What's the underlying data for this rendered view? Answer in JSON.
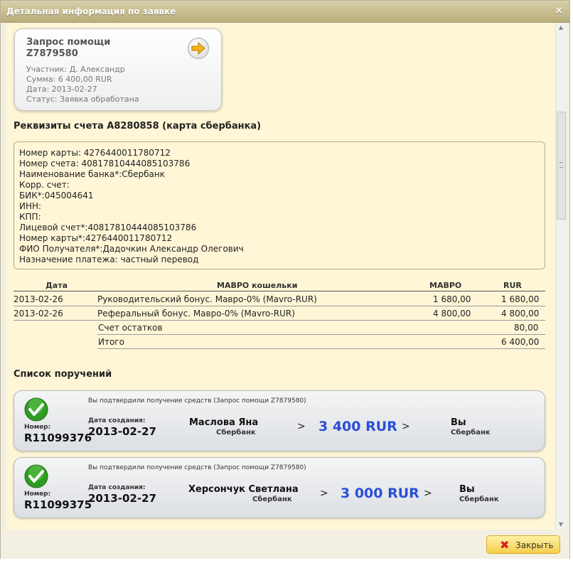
{
  "window": {
    "title": "Детальная информация по заявке",
    "close_glyph": "×"
  },
  "request": {
    "title_line1": "Запрос помощи",
    "title_line2": "Z7879580",
    "participant": "Участник: Д. Александр",
    "sum": "Сумма: 6 400,00 RUR",
    "date": "Дата: 2013-02-27",
    "status": "Статус: Заявка обработана"
  },
  "account": {
    "heading": "Реквизиты счета A8280858 (карта сбербанка)",
    "lines": [
      "Номер карты: 4276440011780712",
      "Номер счета: 40817810444085103786",
      "Наименование банка*:Сбербанк",
      "Корр. счет:",
      "БИК*:045004641",
      "ИНН:",
      "КПП:",
      "Лицевой счет*:40817810444085103786",
      "Номер карты*:4276440011780712",
      "ФИО Получателя*:Дадочкин Александр Олегович",
      "Назначение платежа: частный перевод"
    ]
  },
  "table": {
    "headers": {
      "date": "Дата",
      "wallets": "МАВРО кошельки",
      "mavro": "МАВРО",
      "rur": "RUR"
    },
    "rows": [
      {
        "date": "2013-02-26",
        "wallet": "Руководительский бонус. Мавро-0% (Mavro-RUR)",
        "mavro": "1 680,00",
        "rur": "1 680,00"
      },
      {
        "date": "2013-02-26",
        "wallet": "Реферальный бонус. Мавро-0% (Mavro-RUR)",
        "mavro": "4 800,00",
        "rur": "4 800,00"
      }
    ],
    "balance": {
      "label": "Счет остатков",
      "value": "80,00"
    },
    "total": {
      "label": "Итого",
      "value": "6 400,00"
    }
  },
  "orders": {
    "heading": "Список поручений",
    "items": [
      {
        "note": "Вы подтвердили получение средств (Запрос помощи Z7879580)",
        "number_label": "Номер:",
        "number": "R11099376",
        "date_label": "Дата создания:",
        "date": "2013-02-27",
        "sender_name": "Маслова Яна",
        "sender_bank": "Сбербанк",
        "arrow1": ">",
        "amount": "3 400 RUR",
        "arrow2": ">",
        "recipient_name": "Вы",
        "recipient_bank": "Сбербанк"
      },
      {
        "note": "Вы подтвердили получение средств (Запрос помощи Z7879580)",
        "number_label": "Номер:",
        "number": "R11099375",
        "date_label": "Дата создания:",
        "date": "2013-02-27",
        "sender_name": "Херсончук Светлана",
        "sender_bank": "Сбербанк",
        "arrow1": ">",
        "amount": "3 000 RUR",
        "arrow2": ">",
        "recipient_name": "Вы",
        "recipient_bank": "Сбербанк"
      }
    ]
  },
  "footer": {
    "close_label": "Закрыть",
    "close_glyph": "✖"
  },
  "colors": {
    "content_bg": "#fff6d7",
    "amount_blue": "#2a4ed8",
    "check_green": "#2e9b22",
    "close_button": "#f5d04b"
  }
}
